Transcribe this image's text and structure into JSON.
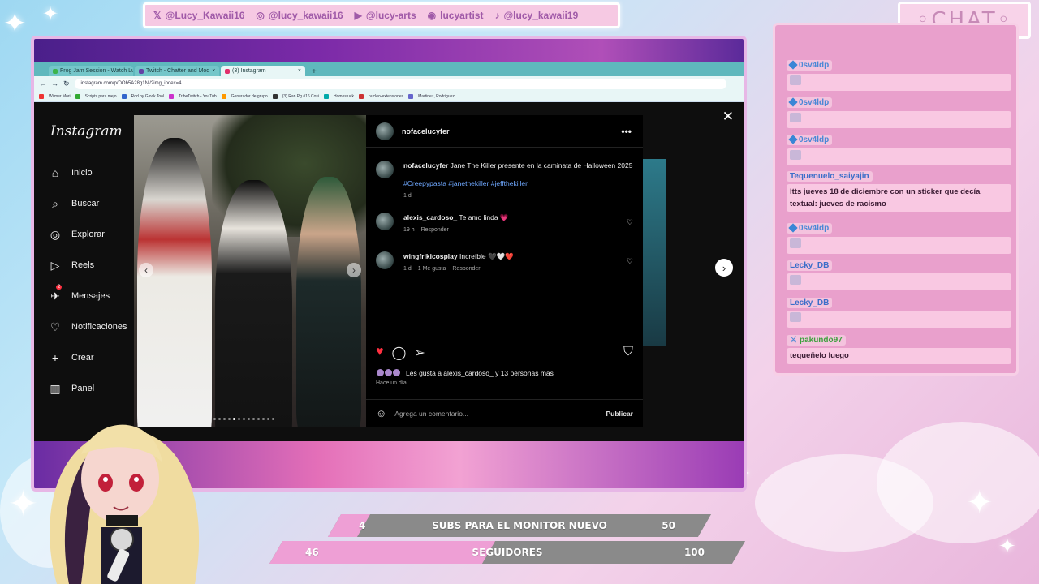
{
  "social": [
    {
      "icon": "x-logo-icon",
      "glyph": "𝕏",
      "handle": "@Lucy_Kawaii16"
    },
    {
      "icon": "instagram-icon",
      "glyph": "◎",
      "handle": "@lucy_kawaii16"
    },
    {
      "icon": "youtube-icon",
      "glyph": "▶",
      "handle": "@lucy-arts"
    },
    {
      "icon": "discord-icon",
      "glyph": "◉",
      "handle": "lucyartist"
    },
    {
      "icon": "tiktok-icon",
      "glyph": "♪",
      "handle": "@lucy_kawaii19"
    }
  ],
  "chat_title": "◦CHAT◦",
  "browser": {
    "tabs": [
      {
        "label": "Frog Jam Session - Watch Lucy",
        "fav": "#3cb44b"
      },
      {
        "label": "Twitch - Chatter and Mod",
        "fav": "#6441a5"
      },
      {
        "label": "(3) Instagram",
        "fav": "#e1306c"
      }
    ],
    "new_tab": "+",
    "url": "instagram.com/p/DOh5A28g1Nj/?img_index=4",
    "bookmarks": [
      "Wilmer Mori",
      "Scripts para mejo",
      "Rod by Glock Tool",
      "TribeTwitch - YouTub",
      "Generador de grupo",
      "(3) Ran Pg #16 Cosi",
      "Homestuck",
      "nucleo-extensiones",
      "Martinez, Rodriguez"
    ]
  },
  "instagram": {
    "logo": "Instagram",
    "nav": [
      {
        "icon": "home-icon",
        "glyph": "⌂",
        "label": "Inicio"
      },
      {
        "icon": "search-icon",
        "glyph": "⌕",
        "label": "Buscar"
      },
      {
        "icon": "compass-icon",
        "glyph": "◎",
        "label": "Explorar"
      },
      {
        "icon": "reels-icon",
        "glyph": "▷",
        "label": "Reels"
      },
      {
        "icon": "messages-icon",
        "glyph": "✈",
        "label": "Mensajes",
        "badge": "2"
      },
      {
        "icon": "heart-icon",
        "glyph": "♡",
        "label": "Notificaciones"
      },
      {
        "icon": "plus-icon",
        "glyph": "+",
        "label": "Crear"
      },
      {
        "icon": "dashboard-icon",
        "glyph": "▥",
        "label": "Panel"
      }
    ],
    "post": {
      "username": "nofacelucyfer",
      "caption_user": "nofacelucyfer",
      "caption": "Jane The Killer presente en la caminata de Halloween 2025",
      "hashtags": "#Creepypasta #janethekiller #jeffthekiller",
      "caption_age": "1 d",
      "comments": [
        {
          "user": "alexis_cardoso_",
          "text": "Te amo linda 💗",
          "age": "19 h",
          "likes": "",
          "reply": "Responder"
        },
        {
          "user": "wingfrikicosplay",
          "text": "Increíble 🖤🤍❤️",
          "age": "1 d",
          "likes": "1 Me gusta",
          "reply": "Responder"
        }
      ],
      "likes_text": "Les gusta a alexis_cardoso_ y 13 personas más",
      "posted": "Hace un día",
      "comment_placeholder": "Agrega un comentario...",
      "publish": "Publicar",
      "liked": true
    }
  },
  "chat": [
    {
      "user": "0sv4ldp",
      "badge": "gem",
      "message": ""
    },
    {
      "user": "0sv4ldp",
      "badge": "gem",
      "message": ""
    },
    {
      "user": "0sv4ldp",
      "badge": "gem",
      "message": ""
    },
    {
      "user": "Tequenuelo_saiyajin",
      "badge": "",
      "message": "ltts jueves 18 de diciembre con un sticker que decía textual: jueves de racismo"
    },
    {
      "user": "0sv4ldp",
      "badge": "gem",
      "message": ""
    },
    {
      "user": "Lecky_DB",
      "badge": "",
      "message": ""
    },
    {
      "user": "Lecky_DB",
      "badge": "",
      "message": ""
    },
    {
      "user": "pakundo97",
      "badge": "mod",
      "message": "tequeñelo luego"
    }
  ],
  "goals": [
    {
      "current": "4",
      "label": "SUBS PARA EL MONITOR NUEVO",
      "target": "50",
      "progress": 0.08
    },
    {
      "current": "46",
      "label": "SEGUIDORES",
      "target": "100",
      "progress": 0.46
    }
  ],
  "colors": {
    "accent_pink": "#ee9fd5",
    "chat_bg": "#e9a0cc",
    "ig_link": "#6fa8ff",
    "like_red": "#ff3040"
  }
}
